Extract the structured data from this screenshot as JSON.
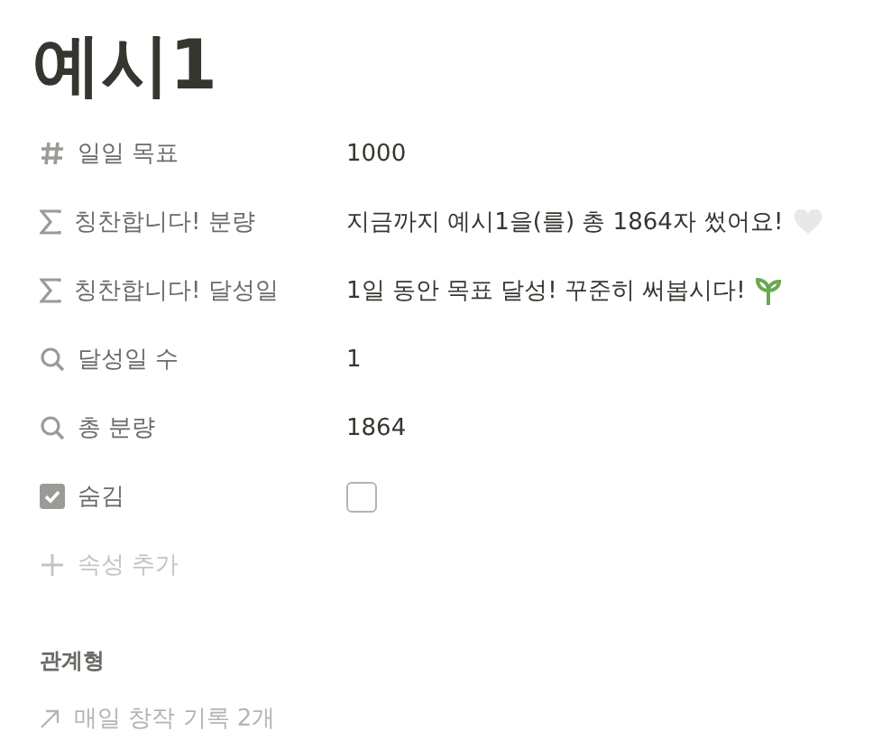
{
  "title": "예시1",
  "properties": [
    {
      "kind": "number",
      "label": "일일 목표",
      "value": "1000"
    },
    {
      "kind": "formula",
      "label": "칭찬합니다! 분량",
      "value": "지금까지 예시1을(를) 총 1864자 썼어요!",
      "badge": {
        "kind": "heart"
      }
    },
    {
      "kind": "formula",
      "label": "칭찬합니다! 달성일",
      "value": "1일 동안 목표 달성! 꾸준히 써봅시다!",
      "badge": {
        "kind": "sprout"
      }
    },
    {
      "kind": "rollup",
      "label": "달성일 수",
      "value": "1"
    },
    {
      "kind": "rollup",
      "label": "총 분량",
      "value": "1864"
    },
    {
      "kind": "checkbox",
      "label": "숨김",
      "checked": false
    }
  ],
  "add_property": "속성 추가",
  "relation": {
    "heading": "관계형",
    "link": "매일 창작 기록 2개"
  }
}
